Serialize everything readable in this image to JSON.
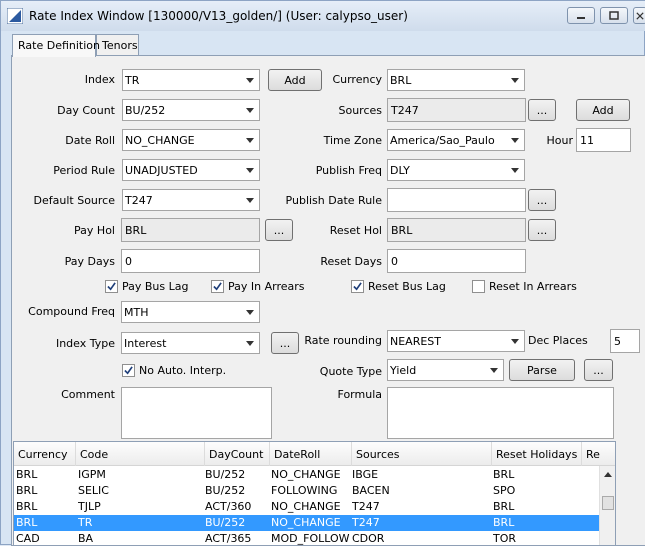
{
  "window": {
    "title": "Rate Index Window  [130000/V13_golden/] (User: calypso_user)",
    "controls": [
      "minimize",
      "maximize",
      "close"
    ]
  },
  "tabs": [
    {
      "label": "Rate Definition",
      "active": true
    },
    {
      "label": "Tenors",
      "active": false
    }
  ],
  "form": {
    "index": {
      "label": "Index",
      "value": "TR"
    },
    "index_add": "Add",
    "currency": {
      "label": "Currency",
      "value": "BRL"
    },
    "day_count": {
      "label": "Day Count",
      "value": "BU/252"
    },
    "sources": {
      "label": "Sources",
      "value": "T247"
    },
    "sources_more": "...",
    "sources_add": "Add",
    "date_roll": {
      "label": "Date Roll",
      "value": "NO_CHANGE"
    },
    "time_zone": {
      "label": "Time Zone",
      "value": "America/Sao_Paulo"
    },
    "hour": {
      "label": "Hour",
      "value": "11"
    },
    "period_rule": {
      "label": "Period Rule",
      "value": "UNADJUSTED"
    },
    "publish_freq": {
      "label": "Publish Freq",
      "value": "DLY"
    },
    "default_source": {
      "label": "Default Source",
      "value": "T247"
    },
    "publish_date_rule": {
      "label": "Publish Date Rule",
      "value": ""
    },
    "publish_date_rule_more": "...",
    "pay_hol": {
      "label": "Pay Hol",
      "value": "BRL"
    },
    "pay_hol_more": "...",
    "reset_hol": {
      "label": "Reset Hol",
      "value": "BRL"
    },
    "reset_hol_more": "...",
    "pay_days": {
      "label": "Pay Days",
      "value": "0"
    },
    "reset_days": {
      "label": "Reset Days",
      "value": "0"
    },
    "pay_bus_lag": {
      "label": "Pay Bus Lag",
      "checked": true
    },
    "pay_in_arrears": {
      "label": "Pay In Arrears",
      "checked": true
    },
    "reset_bus_lag": {
      "label": "Reset Bus Lag",
      "checked": true
    },
    "reset_in_arrears": {
      "label": "Reset In Arrears",
      "checked": false
    },
    "compound_freq": {
      "label": "Compound Freq",
      "value": "MTH"
    },
    "index_type": {
      "label": "Index Type",
      "value": "Interest"
    },
    "index_type_more": "...",
    "rate_rounding": {
      "label": "Rate rounding",
      "value": "NEAREST"
    },
    "dec_places": {
      "label": "Dec Places",
      "value": "5"
    },
    "no_auto_interp": {
      "label": "No Auto. Interp.",
      "checked": true
    },
    "quote_type": {
      "label": "Quote Type",
      "value": "Yield"
    },
    "parse": "Parse",
    "quote_more": "...",
    "comment": {
      "label": "Comment",
      "value": ""
    },
    "formula": {
      "label": "Formula",
      "value": ""
    }
  },
  "table": {
    "columns": [
      "Currency",
      "Code",
      "DayCount",
      "DateRoll",
      "Sources",
      "Reset Holidays",
      "Re"
    ],
    "rows": [
      [
        "BRL",
        "IGPM",
        "BU/252",
        "NO_CHANGE",
        "IBGE",
        "BRL"
      ],
      [
        "BRL",
        "SELIC",
        "BU/252",
        "FOLLOWING",
        "BACEN",
        "SPO"
      ],
      [
        "BRL",
        "TJLP",
        "ACT/360",
        "NO_CHANGE",
        "T247",
        "BRL"
      ],
      [
        "BRL",
        "TR",
        "BU/252",
        "NO_CHANGE",
        "T247",
        "BRL"
      ],
      [
        "CAD",
        "BA",
        "ACT/365",
        "MOD_FOLLOW",
        "CDOR",
        "TOR"
      ]
    ],
    "selected_row": 3
  },
  "colors": {
    "selection": "#3399ff",
    "window_bg": "#d8e5f3",
    "panel_bg": "#f0f0f0"
  },
  "icons": [
    "app-logo-icon",
    "minimize-icon",
    "maximize-icon",
    "close-icon",
    "dropdown-arrow-icon",
    "checkmark-icon",
    "scroll-up-icon"
  ]
}
